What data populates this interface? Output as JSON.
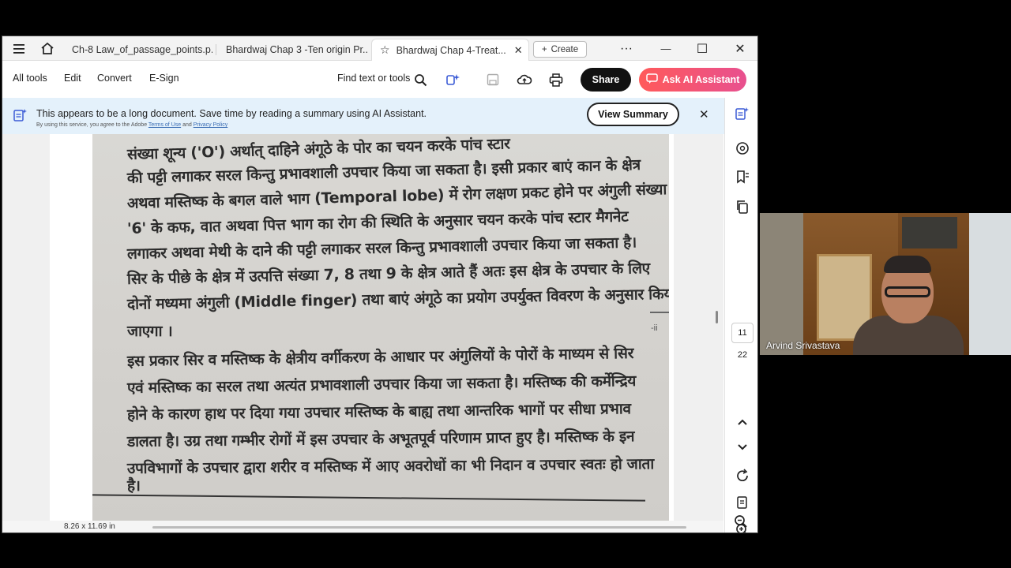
{
  "tabs": [
    {
      "label": "Ch-8 Law_of_passage_points.p..."
    },
    {
      "label": "Bhardwaj Chap 3 -Ten origin Pr..."
    },
    {
      "label": "Bhardwaj Chap 4-Treat...",
      "close": "✕"
    }
  ],
  "window": {
    "create_label": "Create",
    "more": "···",
    "minimize": "—",
    "maximize": "☐",
    "close": "✕"
  },
  "toolbar": {
    "all_tools": "All tools",
    "edit": "Edit",
    "convert": "Convert",
    "esign": "E-Sign",
    "find": "Find text or tools",
    "share": "Share",
    "ask_ai": "Ask AI Assistant"
  },
  "banner": {
    "text": "This appears to be a long document. Save time by reading a summary using AI Assistant.",
    "sub_prefix": "By using this service, you agree to the Adobe ",
    "terms": "Terms of Use",
    "and": " and ",
    "privacy": "Privacy Policy",
    "view_summary": "View Summary",
    "close": "✕"
  },
  "document": {
    "lines": [
      "संख्या शून्य ('O') अर्थात् दाहिने अंगूठे के पोर का चयन करके पांच स्टार",
      "की पट्टी लगाकर सरल किन्तु प्रभावशाली उपचार किया जा सकता है। इसी प्रकार बाएं कान के क्षेत्र",
      "अथवा मस्तिष्क के बगल वाले भाग (Temporal lobe) में रोग लक्षण प्रकट होने पर अंगुली संख्या",
      "'6' के कफ, वात अथवा पित्त भाग का रोग की स्थिति के अनुसार चयन करके पांच स्टार मैगनेट",
      "लगाकर अथवा मेथी के दाने की पट्टी लगाकर सरल किन्तु प्रभावशाली उपचार किया जा सकता है।",
      "सिर के पीछे के क्षेत्र में उत्पत्ति संख्या 7, 8 तथा 9 के क्षेत्र आते हैं अतः इस क्षेत्र के उपचार के लिए",
      "दोनों मध्यमा अंगुली (Middle finger) तथा बाएं अंगूठे का प्रयोग उपर्युक्त विवरण के अनुसार किया",
      "जाएगा ।",
      "इस प्रकार सिर व मस्तिष्क के क्षेत्रीय वर्गीकरण के आधार पर अंगुलियों के पोरों के माध्यम से सिर",
      "एवं मस्तिष्क का सरल तथा अत्यंत प्रभावशाली उपचार किया जा सकता है। मस्तिष्क की कर्मेन्द्रिय",
      "होने के कारण हाथ पर दिया गया उपचार मस्तिष्क के बाह्य तथा आन्तरिक भागों पर सीधा प्रभाव",
      "डालता है। उग्र तथा गम्भीर रोगों में इस उपचार के अभूतपूर्व परिणाम प्राप्त हुए है। मस्तिष्क के इन",
      "उपविभागों के उपचार द्वारा शरीर व मस्तिष्क में आए अवरोधों का भी निदान व उपचार स्वतः हो जाता",
      "है।"
    ],
    "edge_mark": "-ii",
    "page_size": "8.26 x 11.69 in"
  },
  "pagination": {
    "current": "11",
    "total": "22"
  },
  "video": {
    "participant_name": "Arvind Srivastava"
  },
  "colors": {
    "ai_gradient_start": "#ff5a5a",
    "ai_gradient_end": "#e8508f",
    "banner_bg": "#e4f1fb",
    "share_bg": "#111111"
  }
}
